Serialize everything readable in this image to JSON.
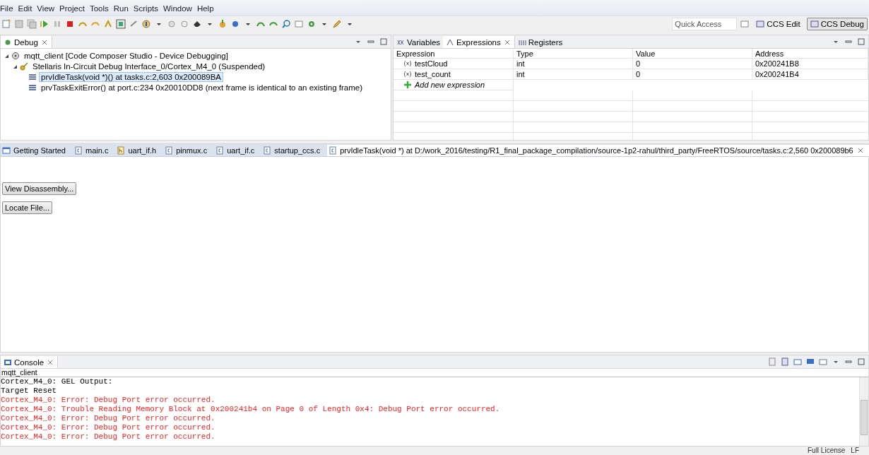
{
  "menu": [
    "File",
    "Edit",
    "View",
    "Project",
    "Tools",
    "Run",
    "Scripts",
    "Window",
    "Help"
  ],
  "toolbar": {
    "quick_access": {
      "placeholder": "Quick Access"
    },
    "perspectives": [
      {
        "label": "CCS Edit",
        "selected": false
      },
      {
        "label": "CCS Debug",
        "selected": true
      }
    ]
  },
  "debug": {
    "tab": "Debug",
    "tree": [
      {
        "label": "mqtt_client [Code Composer Studio - Device Debugging]",
        "kind": "project",
        "expanded": true,
        "selected": false,
        "children": [
          {
            "label": "Stellaris In-Circuit Debug Interface_0/Cortex_M4_0 (Suspended)",
            "kind": "target",
            "expanded": true,
            "selected": false,
            "children": [
              {
                "label": "prvIdleTask(void *)() at tasks.c:2,603 0x200089BA",
                "kind": "frame",
                "selected": true
              },
              {
                "label": "prvTaskExitError() at port.c:234 0x20010DD8  (next frame is identical to an existing frame)",
                "kind": "frame",
                "selected": false
              }
            ]
          }
        ]
      }
    ]
  },
  "expressions": {
    "tabs": [
      {
        "label": "Variables",
        "kind": "variables",
        "selected": false
      },
      {
        "label": "Expressions",
        "kind": "expressions",
        "selected": true
      },
      {
        "label": "Registers",
        "kind": "registers",
        "selected": false
      }
    ],
    "columns": [
      "Expression",
      "Type",
      "Value",
      "Address"
    ],
    "rows": [
      {
        "expression": "testCloud",
        "type": "int",
        "value": "0",
        "address": "0x200241B8"
      },
      {
        "expression": "test_count",
        "type": "int",
        "value": "0",
        "address": "0x200241B4"
      }
    ],
    "add_row": "Add new expression"
  },
  "editor": {
    "tabs": [
      {
        "label": "Getting Started",
        "kind": "window",
        "selected": false
      },
      {
        "label": "main.c",
        "kind": "c",
        "selected": false
      },
      {
        "label": "uart_if.h",
        "kind": "h",
        "selected": false
      },
      {
        "label": "pinmux.c",
        "kind": "c",
        "selected": false
      },
      {
        "label": "uart_if.c",
        "kind": "c",
        "selected": false
      },
      {
        "label": "startup_ccs.c",
        "kind": "c",
        "selected": false
      },
      {
        "label": "prvIdleTask(void *) at D:/work_2016/testing/R1_final_package_compilation/source-1p2-rahul/third_party/FreeRTOS/source/tasks.c:2,560 0x200089b6",
        "kind": "c",
        "selected": true
      }
    ],
    "buttons": [
      "View Disassembly...",
      "Locate File..."
    ]
  },
  "console": {
    "tab": "Console",
    "title": "mqtt_client",
    "lines": [
      {
        "text": "Cortex_M4_0: GEL Output:",
        "kind": "info"
      },
      {
        "text": "Target Reset",
        "kind": "info"
      },
      {
        "text": "Cortex_M4_0: Error: Debug Port error occurred.",
        "kind": "error"
      },
      {
        "text": "Cortex_M4_0: Trouble Reading Memory Block at 0x200241b4 on Page 0 of Length 0x4: Debug Port error occurred.",
        "kind": "error"
      },
      {
        "text": "Cortex_M4_0: Error: Debug Port error occurred.",
        "kind": "error"
      },
      {
        "text": "Cortex_M4_0: Error: Debug Port error occurred.",
        "kind": "error"
      },
      {
        "text": "Cortex_M4_0: Error: Debug Port error occurred.",
        "kind": "error"
      }
    ]
  },
  "status_bar": [
    "Full License",
    "LF"
  ]
}
